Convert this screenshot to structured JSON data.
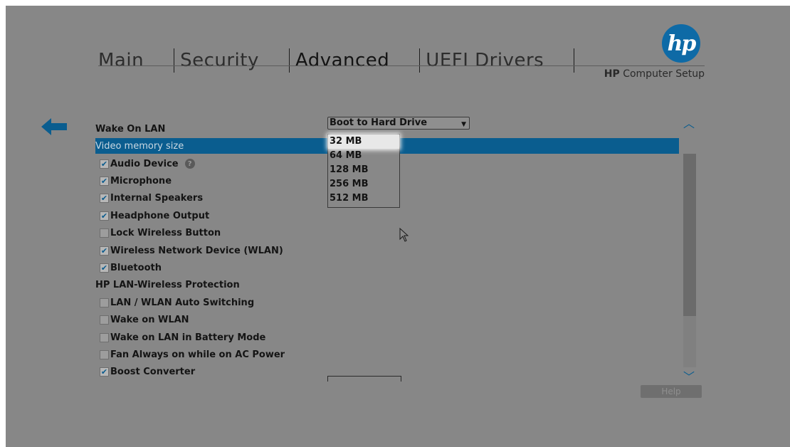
{
  "tabs": [
    {
      "label": "Main"
    },
    {
      "label": "Security"
    },
    {
      "label": "Advanced"
    },
    {
      "label": "UEFI Drivers"
    }
  ],
  "active_tab": "Advanced",
  "brand": {
    "logo_text": "hp",
    "subtitle_bold": "HP",
    "subtitle_rest": " Computer Setup",
    "accent": "#0a5d8f"
  },
  "wake_on_lan": {
    "label": "Wake On LAN",
    "value": "Boot to Hard Drive"
  },
  "video_memory": {
    "label": "Video memory size",
    "options": [
      "32 MB",
      "64 MB",
      "128 MB",
      "256 MB",
      "512 MB"
    ],
    "highlighted": "32 MB"
  },
  "settings": [
    {
      "label": "Audio Device",
      "checked": true,
      "help": "?"
    },
    {
      "label": "Microphone",
      "checked": true
    },
    {
      "label": "Internal Speakers",
      "checked": true
    },
    {
      "label": "Headphone Output",
      "checked": true
    },
    {
      "label": "Lock Wireless Button",
      "checked": false
    },
    {
      "label": "Wireless Network Device (WLAN)",
      "checked": true
    },
    {
      "label": "Bluetooth",
      "checked": true
    },
    {
      "label": "HP LAN-Wireless Protection",
      "header": true
    },
    {
      "label": " LAN / WLAN Auto Switching",
      "checked": false
    },
    {
      "label": "Wake on WLAN",
      "checked": false
    },
    {
      "label": "Wake on LAN in Battery Mode",
      "checked": false
    },
    {
      "label": "Fan Always on while on AC Power",
      "checked": false
    },
    {
      "label": "Boost Converter",
      "checked": true
    }
  ],
  "help_label": "Help",
  "icons": {
    "back": "back-arrow-icon",
    "up": "chevron-up-icon",
    "down": "chevron-down-icon",
    "cursor": "mouse-pointer-icon"
  }
}
